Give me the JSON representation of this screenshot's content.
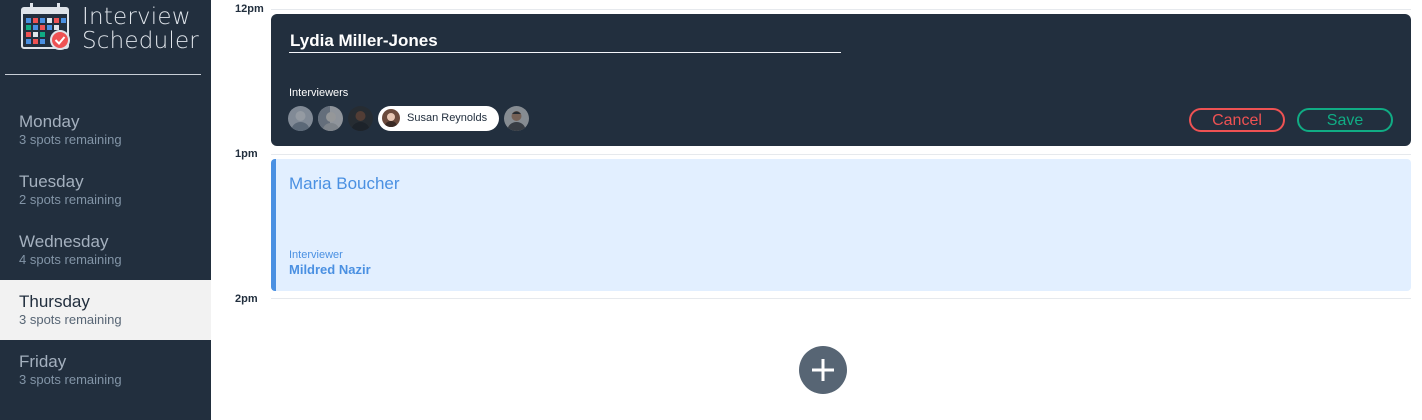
{
  "app": {
    "title_line1": "Interview",
    "title_line2": "Scheduler"
  },
  "sidebar": {
    "days": [
      {
        "name": "Monday",
        "spots": "3 spots remaining",
        "selected": false
      },
      {
        "name": "Tuesday",
        "spots": "2 spots remaining",
        "selected": false
      },
      {
        "name": "Wednesday",
        "spots": "4 spots remaining",
        "selected": false
      },
      {
        "name": "Thursday",
        "spots": "3 spots remaining",
        "selected": true
      },
      {
        "name": "Friday",
        "spots": "3 spots remaining",
        "selected": false
      }
    ]
  },
  "schedule": {
    "times": [
      "12pm",
      "1pm",
      "2pm"
    ],
    "edit_appointment": {
      "student_name": "Lydia Miller-Jones",
      "interviewers_label": "Interviewers",
      "selected_interviewer": "Susan Reynolds",
      "cancel_label": "Cancel",
      "save_label": "Save"
    },
    "booked_appointment": {
      "student_name": "Maria Boucher",
      "interviewer_label": "Interviewer",
      "interviewer_name": "Mildred Nazir"
    }
  },
  "colors": {
    "sidebar_bg": "#222f3e",
    "accent_blue": "#4a90e2",
    "cancel_red": "#ee5253",
    "save_green": "#10ac84",
    "add_button": "#576574"
  }
}
